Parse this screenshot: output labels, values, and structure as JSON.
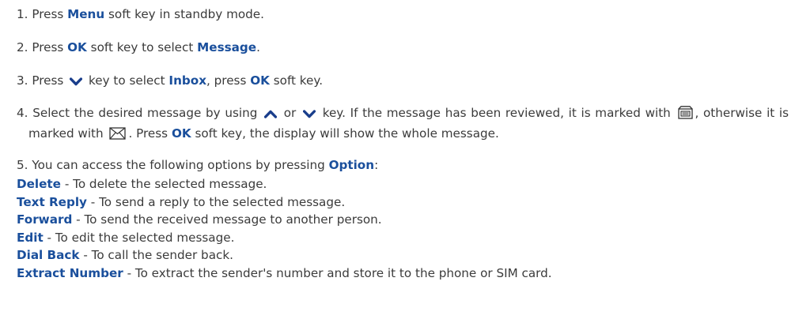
{
  "steps": {
    "s1": {
      "num": "1.",
      "t1": "Press",
      "k1": "Menu",
      "t2": "soft key in standby mode."
    },
    "s2": {
      "num": "2.",
      "t1": "Press",
      "k1": "OK",
      "t2": "soft key to select",
      "k2": "Message",
      "t3": "."
    },
    "s3": {
      "num": "3.",
      "t1": "Press",
      "t2": "key to select",
      "k1": "Inbox",
      "t3": ", press",
      "k2": "OK",
      "t4": "soft key."
    },
    "s4": {
      "num": "4.",
      "t1": "Select the desired message by using",
      "t2": "or",
      "t3": "key. If the message has been reviewed, it is marked with",
      "t4": ", otherwise it is marked with",
      "t5": ". Press",
      "k1": "OK",
      "t6": "soft key, the display will show the whole message."
    },
    "s5": {
      "num": "5.",
      "t1": "You can access the following options by pressing",
      "k1": "Option",
      "t2": ":"
    }
  },
  "options": [
    {
      "label": "Delete",
      "desc": "- To delete the selected message."
    },
    {
      "label": "Text Reply",
      "desc": "- To send a reply to the selected message."
    },
    {
      "label": "Forward",
      "desc": "- To send the received message to another person."
    },
    {
      "label": "Edit",
      "desc": "- To edit the selected message."
    },
    {
      "label": "Dial Back",
      "desc": "- To call the sender back."
    },
    {
      "label": "Extract Number",
      "desc": "- To extract the sender's number and store it to the phone or SIM card."
    }
  ],
  "icons": {
    "down": "chevron-down-icon",
    "up": "chevron-up-icon",
    "read": "read-message-icon",
    "unread": "unread-envelope-icon"
  },
  "colors": {
    "keyword": "#1a4f9c",
    "text": "#3b3b3b",
    "icon": "#1a3e8c"
  }
}
